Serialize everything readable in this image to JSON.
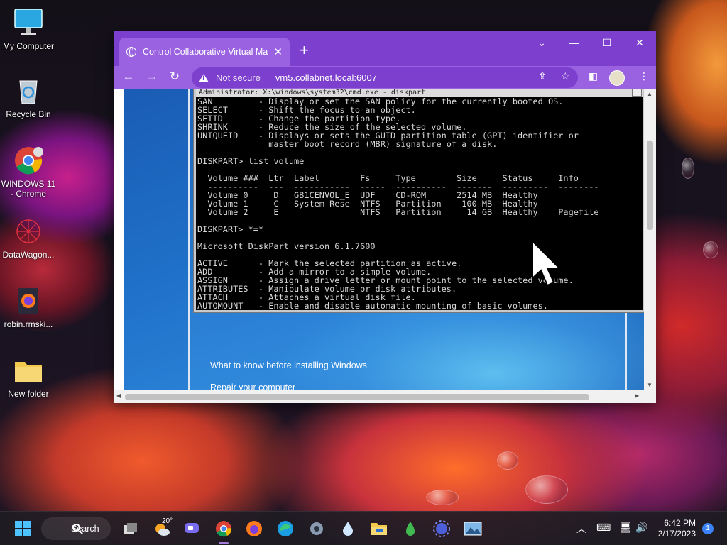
{
  "desktop": {
    "icons": [
      {
        "label": "My Computer",
        "icon": "monitor-icon"
      },
      {
        "label": "Recycle Bin",
        "icon": "recycle-bin-icon"
      },
      {
        "label": "WINDOWS 11 - Chrome",
        "icon": "chrome-icon"
      },
      {
        "label": "DataWagon...",
        "icon": "datawagon-icon"
      },
      {
        "label": "robin.rmski...",
        "icon": "firefox-file-icon"
      },
      {
        "label": "New folder",
        "icon": "folder-icon"
      }
    ]
  },
  "browser": {
    "tab_title": "Control Collaborative Virtual Ma",
    "tab_close": "✕",
    "new_tab": "+",
    "window_controls": [
      "⌄",
      "—",
      "☐",
      "✕"
    ],
    "nav": {
      "back": "←",
      "forward": "→",
      "reload": "↻"
    },
    "security_label": "Not secure",
    "url": "vm5.collabnet.local:6007",
    "accent_color": "#7d3fcd",
    "toolbar_color": "#9a62e0"
  },
  "vm": {
    "cmd_title": "Administrator: X:\\windows\\system32\\cmd.exe - diskpart",
    "cmd_lines": [
      "SAN         - Display or set the SAN policy for the currently booted OS.",
      "SELECT      - Shift the focus to an object.",
      "SETID       - Change the partition type.",
      "SHRINK      - Reduce the size of the selected volume.",
      "UNIQUEID    - Displays or sets the GUID partition table (GPT) identifier or",
      "              master boot record (MBR) signature of a disk.",
      "",
      "DISKPART> list volume",
      "",
      "  Volume ###  Ltr  Label        Fs     Type        Size     Status     Info",
      "  ----------  ---  -----------  -----  ----------  -------  ---------  --------",
      "  Volume 0     D   GB1CENVOL_E  UDF    CD-ROM      2514 MB  Healthy",
      "  Volume 1     C   System Rese  NTFS   Partition    100 MB  Healthy",
      "  Volume 2     E                NTFS   Partition     14 GB  Healthy    Pagefile",
      "",
      "DISKPART> *=*",
      "",
      "Microsoft DiskPart version 6.1.7600",
      "",
      "ACTIVE      - Mark the selected partition as active.",
      "ADD         - Add a mirror to a simple volume.",
      "ASSIGN      - Assign a drive letter or mount point to the selected volume.",
      "ATTRIBUTES  - Manipulate volume or disk attributes.",
      "ATTACH      - Attaches a virtual disk file.",
      "AUTOMOUNT   - Enable and disable automatic mounting of basic volumes."
    ],
    "setup_link_1": "What to know before installing Windows",
    "setup_link_2": "Repair your computer"
  },
  "taskbar": {
    "search_label": "Search",
    "weather_temp": "20°",
    "apps": [
      "windows-start-icon",
      "task-view-icon",
      "weather-icon",
      "chat-icon",
      "chrome-icon",
      "firefox-icon",
      "edge-icon",
      "settings-icon",
      "droplet-icon",
      "file-explorer-icon",
      "leaf-icon",
      "gear-burst-icon",
      "photos-icon"
    ],
    "time": "6:42 PM",
    "date": "2/17/2023",
    "notification_count": "1"
  }
}
